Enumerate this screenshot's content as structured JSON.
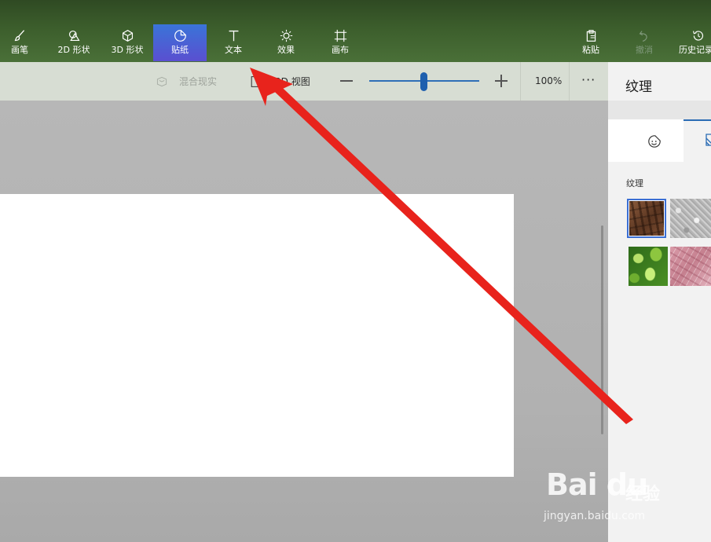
{
  "toolbar": {
    "tools": [
      {
        "label": "画笔",
        "icon": "brush-icon"
      },
      {
        "label": "2D 形状",
        "icon": "2d-shapes-icon"
      },
      {
        "label": "3D 形状",
        "icon": "3d-cube-icon"
      },
      {
        "label": "贴纸",
        "icon": "sticker-icon",
        "active": true
      },
      {
        "label": "文本",
        "icon": "text-t-icon"
      },
      {
        "label": "效果",
        "icon": "sun-effects-icon"
      },
      {
        "label": "画布",
        "icon": "canvas-crop-icon"
      }
    ],
    "actions": [
      {
        "label": "粘贴",
        "icon": "clipboard-paste-icon"
      },
      {
        "label": "撤消",
        "icon": "undo-icon",
        "disabled": true
      },
      {
        "label": "历史记录",
        "icon": "history-icon"
      }
    ]
  },
  "subbar": {
    "mixed_reality": "混合现实",
    "view_3d": "3D 视图",
    "zoom_level": "100%",
    "zoom_fraction": 0.5,
    "more": "···"
  },
  "panel": {
    "title": "纹理",
    "section_label": "纹理",
    "textures": [
      "bark",
      "stone",
      "leaves",
      "pink-marble"
    ],
    "selected_texture": "bark"
  },
  "watermark": {
    "logo": "Bai du",
    "brand": "经验",
    "url": "jingyan.baidu.com"
  },
  "colors": {
    "active_tab": "#3a74d8",
    "accent": "#2b6cb4",
    "annotation_arrow": "#e8231c"
  }
}
